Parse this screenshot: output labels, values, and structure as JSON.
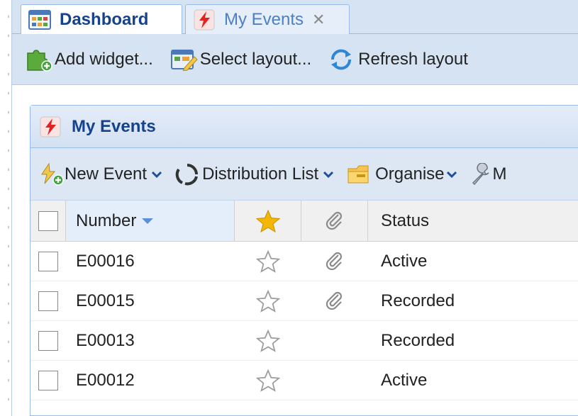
{
  "tabs": [
    {
      "label": "Dashboard",
      "icon": "dashboard-icon",
      "active": true
    },
    {
      "label": "My Events",
      "icon": "event-icon",
      "active": false,
      "close_icon": "close-icon"
    }
  ],
  "toolbar": {
    "add_widget": "Add widget...",
    "select_layout": "Select layout...",
    "refresh_layout": "Refresh layout"
  },
  "panel": {
    "title": "My Events",
    "toolbar": {
      "new_event": "New Event",
      "distribution_list": "Distribution List",
      "organise": "Organise",
      "more": "M"
    }
  },
  "grid": {
    "columns": {
      "number": "Number",
      "status": "Status"
    },
    "rows": [
      {
        "number": "E00016",
        "starred": false,
        "attachment": true,
        "status": "Active"
      },
      {
        "number": "E00015",
        "starred": false,
        "attachment": true,
        "status": "Recorded"
      },
      {
        "number": "E00013",
        "starred": false,
        "attachment": false,
        "status": "Recorded"
      },
      {
        "number": "E00012",
        "starred": false,
        "attachment": false,
        "status": "Active"
      }
    ]
  },
  "colors": {
    "accent": "#15428b",
    "tab_inactive_text": "#4d7fc3",
    "star_gold": "#f2b705",
    "header_bg": "#d6e3f3"
  }
}
